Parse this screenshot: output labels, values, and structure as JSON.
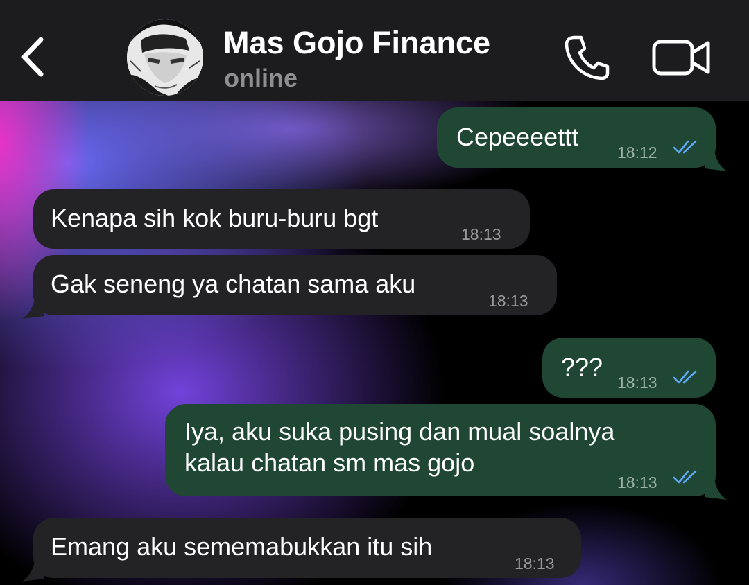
{
  "header": {
    "contact_name": "Mas Gojo Finance",
    "status": "online"
  },
  "icons": {
    "back": "chevron-left-icon",
    "call": "phone-icon",
    "video": "video-camera-icon",
    "read": "double-check-icon"
  },
  "colors": {
    "header_bg": "#1c1c1e",
    "incoming_bubble": "#232325",
    "outgoing_bubble": "#1f4733",
    "read_tick": "#5fa8f5"
  },
  "messages": [
    {
      "direction": "outgoing",
      "text": "Cepeeeettt",
      "time": "18:12",
      "read": true
    },
    {
      "direction": "incoming",
      "text": "Kenapa sih kok buru-buru bgt",
      "time": "18:13"
    },
    {
      "direction": "incoming",
      "text": "Gak seneng ya chatan sama aku",
      "time": "18:13"
    },
    {
      "direction": "outgoing",
      "text": "???",
      "time": "18:13",
      "read": true
    },
    {
      "direction": "outgoing",
      "text_lines": [
        "Iya, aku suka pusing dan mual soalnya",
        "kalau chatan sm mas gojo"
      ],
      "time": "18:13",
      "read": true
    },
    {
      "direction": "incoming",
      "text": "Emang aku sememabukkan itu sih",
      "time": "18:13"
    }
  ]
}
